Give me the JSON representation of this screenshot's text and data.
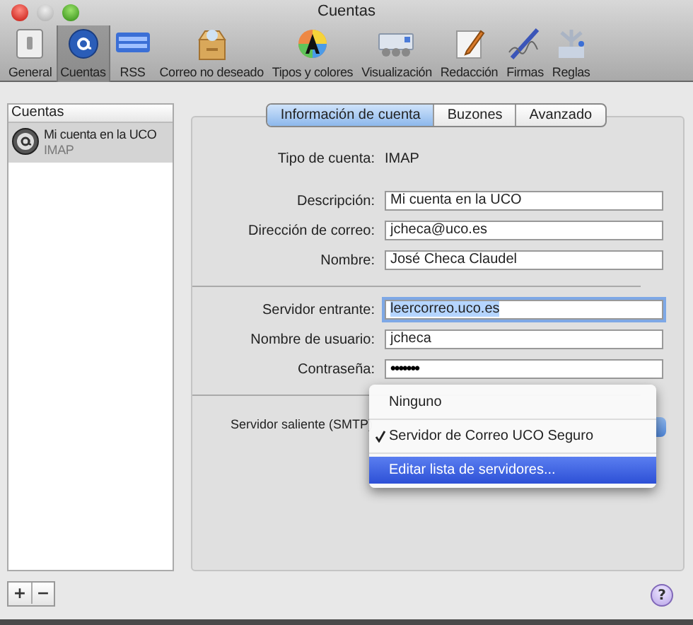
{
  "window": {
    "title": "Cuentas"
  },
  "toolbar": {
    "items": [
      {
        "label": "General",
        "selected": false
      },
      {
        "label": "Cuentas",
        "selected": true
      },
      {
        "label": "RSS",
        "selected": false
      },
      {
        "label": "Correo no deseado",
        "selected": false
      },
      {
        "label": "Tipos y colores",
        "selected": false
      },
      {
        "label": "Visualización",
        "selected": false
      },
      {
        "label": "Redacción",
        "selected": false
      },
      {
        "label": "Firmas",
        "selected": false
      },
      {
        "label": "Reglas",
        "selected": false
      }
    ]
  },
  "accounts_list": {
    "header": "Cuentas",
    "items": [
      {
        "name": "Mi cuenta en la UCO",
        "type": "IMAP",
        "selected": true
      }
    ]
  },
  "tabs": [
    {
      "label": "Información de cuenta",
      "selected": true
    },
    {
      "label": "Buzones",
      "selected": false
    },
    {
      "label": "Avanzado",
      "selected": false
    }
  ],
  "account_type": {
    "label": "Tipo de cuenta:",
    "value": "IMAP"
  },
  "sections": [
    {
      "fields": [
        {
          "label": "Descripción:",
          "value": "Mi cuenta en la UCO",
          "focused": false
        },
        {
          "label": "Dirección de correo:",
          "value": "jcheca@uco.es",
          "focused": false
        },
        {
          "label": "Nombre:",
          "value": "José Checa Claudel",
          "focused": false
        }
      ]
    },
    {
      "fields": [
        {
          "label": "Servidor entrante:",
          "value": "leercorreo.uco.es",
          "focused": true
        },
        {
          "label": "Nombre de usuario:",
          "value": "jcheca",
          "focused": false
        },
        {
          "label": "Contraseña:",
          "value": "•••••••",
          "focused": false
        }
      ]
    }
  ],
  "outgoing": {
    "label": "Servidor saliente (SMTP)"
  },
  "menu": {
    "items": [
      {
        "label": "Ninguno",
        "checked": false,
        "highlighted": false
      },
      {
        "label": "Servidor de Correo UCO Seguro",
        "checked": true,
        "highlighted": false
      },
      {
        "label": "Editar lista de servidores...",
        "checked": false,
        "highlighted": true
      }
    ]
  },
  "footer": {
    "add": "+",
    "remove": "−",
    "help": "?"
  }
}
